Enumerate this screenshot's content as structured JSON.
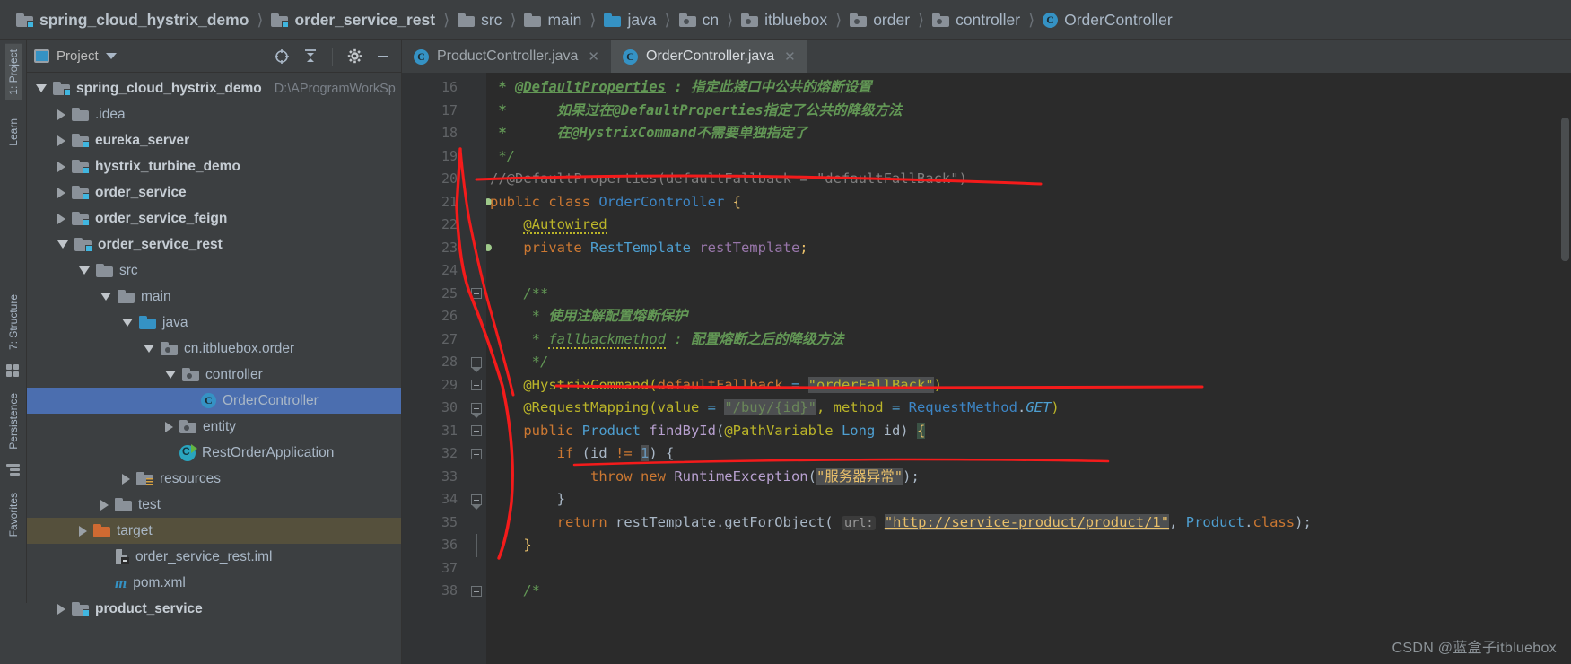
{
  "breadcrumb": [
    {
      "label": "spring_cloud_hystrix_demo",
      "icon": "module-folder-icon",
      "bold": true
    },
    {
      "label": "order_service_rest",
      "icon": "module-folder-icon",
      "bold": true
    },
    {
      "label": "src",
      "icon": "folder-icon",
      "bold": false
    },
    {
      "label": "main",
      "icon": "folder-icon",
      "bold": false
    },
    {
      "label": "java",
      "icon": "source-folder-icon",
      "bold": false
    },
    {
      "label": "cn",
      "icon": "package-icon",
      "bold": false
    },
    {
      "label": "itbluebox",
      "icon": "package-icon",
      "bold": false
    },
    {
      "label": "order",
      "icon": "package-icon",
      "bold": false
    },
    {
      "label": "controller",
      "icon": "package-icon",
      "bold": false
    },
    {
      "label": "OrderController",
      "icon": "class-icon",
      "bold": false
    }
  ],
  "left_strip": {
    "tabs": [
      {
        "label": "1: Project",
        "active": true
      },
      {
        "label": "Learn",
        "active": false
      },
      {
        "label": "7: Structure",
        "active": false
      },
      {
        "label": "Persistence",
        "active": false
      },
      {
        "label": "Favorites",
        "active": false
      }
    ]
  },
  "project_panel": {
    "title": "Project",
    "icons": [
      "project-view-icon",
      "chevron-down-icon",
      "locate-icon",
      "collapse-all-icon",
      "settings-gear-icon",
      "hide-panel-icon"
    ],
    "tree": [
      {
        "label": "spring_cloud_hystrix_demo",
        "path": "D:\\AProgramWorkSp",
        "depth": 0,
        "toggle": "down",
        "icon": "module-folder-icon",
        "bold": true,
        "state": "normal"
      },
      {
        "label": ".idea",
        "path": "",
        "depth": 1,
        "toggle": "right",
        "icon": "folder-icon",
        "bold": false,
        "state": "normal"
      },
      {
        "label": "eureka_server",
        "path": "",
        "depth": 1,
        "toggle": "right",
        "icon": "module-folder-icon",
        "bold": true,
        "state": "normal"
      },
      {
        "label": "hystrix_turbine_demo",
        "path": "",
        "depth": 1,
        "toggle": "right",
        "icon": "module-folder-icon",
        "bold": true,
        "state": "normal"
      },
      {
        "label": "order_service",
        "path": "",
        "depth": 1,
        "toggle": "right",
        "icon": "module-folder-icon",
        "bold": true,
        "state": "normal"
      },
      {
        "label": "order_service_feign",
        "path": "",
        "depth": 1,
        "toggle": "right",
        "icon": "module-folder-icon",
        "bold": true,
        "state": "normal"
      },
      {
        "label": "order_service_rest",
        "path": "",
        "depth": 1,
        "toggle": "down",
        "icon": "module-folder-icon",
        "bold": true,
        "state": "normal"
      },
      {
        "label": "src",
        "path": "",
        "depth": 2,
        "toggle": "down",
        "icon": "folder-icon",
        "bold": false,
        "state": "normal"
      },
      {
        "label": "main",
        "path": "",
        "depth": 3,
        "toggle": "down",
        "icon": "folder-icon",
        "bold": false,
        "state": "normal"
      },
      {
        "label": "java",
        "path": "",
        "depth": 4,
        "toggle": "down",
        "icon": "source-folder-icon",
        "bold": false,
        "state": "normal"
      },
      {
        "label": "cn.itbluebox.order",
        "path": "",
        "depth": 5,
        "toggle": "down",
        "icon": "package-icon",
        "bold": false,
        "state": "normal"
      },
      {
        "label": "controller",
        "path": "",
        "depth": 6,
        "toggle": "down",
        "icon": "package-icon",
        "bold": false,
        "state": "normal"
      },
      {
        "label": "OrderController",
        "path": "",
        "depth": 7,
        "toggle": "none",
        "icon": "class-icon",
        "bold": false,
        "state": "selected"
      },
      {
        "label": "entity",
        "path": "",
        "depth": 6,
        "toggle": "right",
        "icon": "package-icon",
        "bold": false,
        "state": "normal"
      },
      {
        "label": "RestOrderApplication",
        "path": "",
        "depth": 6,
        "toggle": "none",
        "icon": "springboot-class-icon",
        "bold": false,
        "state": "normal"
      },
      {
        "label": "resources",
        "path": "",
        "depth": 4,
        "toggle": "right",
        "icon": "resources-folder-icon",
        "bold": false,
        "state": "normal"
      },
      {
        "label": "test",
        "path": "",
        "depth": 3,
        "toggle": "right",
        "icon": "folder-icon",
        "bold": false,
        "state": "normal"
      },
      {
        "label": "target",
        "path": "",
        "depth": 2,
        "toggle": "right",
        "icon": "excluded-folder-icon",
        "bold": false,
        "state": "highlight"
      },
      {
        "label": "order_service_rest.iml",
        "path": "",
        "depth": 3,
        "toggle": "none",
        "icon": "iml-file-icon",
        "bold": false,
        "state": "normal"
      },
      {
        "label": "pom.xml",
        "path": "",
        "depth": 3,
        "toggle": "none",
        "icon": "maven-file-icon",
        "bold": false,
        "state": "normal"
      },
      {
        "label": "product_service",
        "path": "",
        "depth": 1,
        "toggle": "right",
        "icon": "module-folder-icon",
        "bold": true,
        "state": "normal"
      }
    ]
  },
  "editor": {
    "tabs": [
      {
        "label": "ProductController.java",
        "icon": "class-icon",
        "active": false,
        "closable": true
      },
      {
        "label": "OrderController.java",
        "icon": "class-icon",
        "active": true,
        "closable": true
      }
    ],
    "first_line_number": 16,
    "lines": [
      {
        "n": 16,
        "text": " * @DefaultProperties : 指定此接口中公共的熔断设置"
      },
      {
        "n": 17,
        "text": " *      如果过在@DefaultProperties指定了公共的降级方法"
      },
      {
        "n": 18,
        "text": " *      在@HystrixCommand不需要单独指定了"
      },
      {
        "n": 19,
        "text": " */"
      },
      {
        "n": 20,
        "text": "//@DefaultProperties(defaultFallback = \"defaultFallBack\")"
      },
      {
        "n": 21,
        "text": "public class OrderController {"
      },
      {
        "n": 22,
        "text": "    @Autowired"
      },
      {
        "n": 23,
        "text": "    private RestTemplate restTemplate;"
      },
      {
        "n": 24,
        "text": ""
      },
      {
        "n": 25,
        "text": "    /**"
      },
      {
        "n": 26,
        "text": "     * 使用注解配置熔断保护"
      },
      {
        "n": 27,
        "text": "     * fallbackmethod : 配置熔断之后的降级方法"
      },
      {
        "n": 28,
        "text": "     */"
      },
      {
        "n": 29,
        "text": "    @HystrixCommand(defaultFallback = \"orderFallBack\")"
      },
      {
        "n": 30,
        "text": "    @RequestMapping(value = \"/buy/{id}\", method = RequestMethod.GET)"
      },
      {
        "n": 31,
        "text": "    public Product findById(@PathVariable Long id) {"
      },
      {
        "n": 32,
        "text": "        if (id != 1) {"
      },
      {
        "n": 33,
        "text": "            throw new RuntimeException(\"服务器异常\");"
      },
      {
        "n": 34,
        "text": "        }"
      },
      {
        "n": 35,
        "text": "        return restTemplate.getForObject( url: \"http://service-product/product/1\", Product.class);"
      },
      {
        "n": 36,
        "text": "    }"
      },
      {
        "n": 37,
        "text": ""
      },
      {
        "n": 38,
        "text": "    /*"
      }
    ],
    "param_hint": "url:",
    "gutter_markers": [
      {
        "line": 21,
        "marker": "spring-bean-icon"
      },
      {
        "line": 23,
        "marker": "autowired-arrow-icon"
      },
      {
        "line": 31,
        "marker": "run-method-icon"
      }
    ]
  },
  "annotation": {
    "color": "#ff0000",
    "type": "hand-drawn-marker"
  },
  "watermark": "CSDN @蓝盒子itbluebox",
  "colors": {
    "ide_bg": "#3c3f41",
    "editor_bg": "#2b2b2b",
    "gutter_bg": "#313335",
    "selection_blue": "#4b6eaf",
    "accent_blue": "#3592c4",
    "text": "#a9b7c6",
    "annotation_red": "#ff0000"
  }
}
